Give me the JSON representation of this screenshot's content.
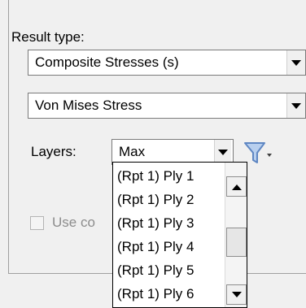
{
  "result_type": {
    "label": "Result type:",
    "type_combo_value": "Composite Stresses (s)",
    "measure_combo_value": "Von Mises Stress"
  },
  "layers": {
    "label": "Layers:",
    "value": "Max",
    "dropdown_items": [
      "(Rpt 1) Ply  1",
      "(Rpt 1) Ply  2",
      "(Rpt 1) Ply  3",
      "(Rpt 1) Ply  4",
      "(Rpt 1) Ply  5",
      "(Rpt 1) Ply  6"
    ]
  },
  "use_option": {
    "label_partial": "Use co"
  },
  "icons": {
    "filter": "filter-funnel-icon",
    "dropdown_arrow": "chevron-down-icon",
    "scroll_up": "scroll-up-arrow-icon",
    "scroll_down": "scroll-down-arrow-icon"
  },
  "colors": {
    "background": "#f0f0f0",
    "filter_icon": "#5f87c3"
  }
}
